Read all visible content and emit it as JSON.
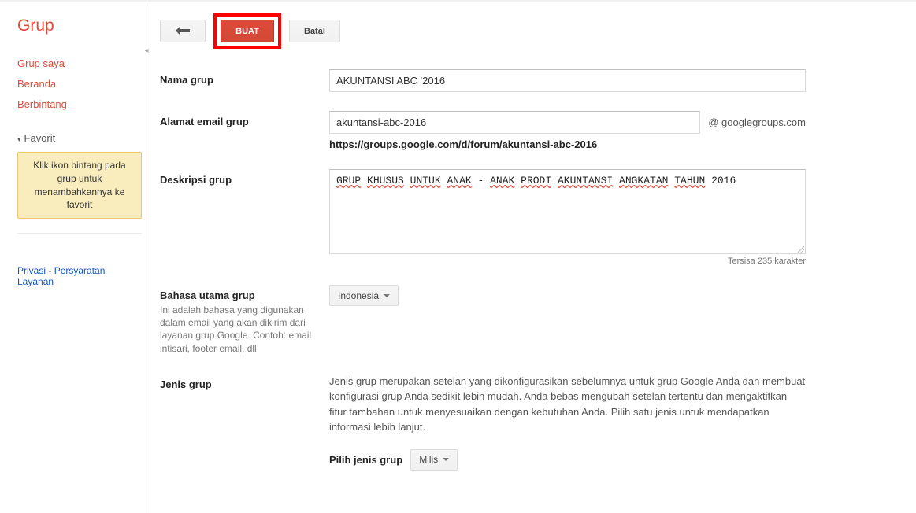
{
  "logo": "Grup",
  "sidebar": {
    "items": [
      "Grup saya",
      "Beranda",
      "Berbintang"
    ],
    "fav_header": "Favorit",
    "fav_tip": "Klik ikon bintang pada grup untuk menambahkannya ke favorit",
    "footer": {
      "privacy": "Privasi",
      "terms": "Persyaratan Layanan"
    }
  },
  "toolbar": {
    "buat": "BUAT",
    "batal": "Batal"
  },
  "form": {
    "name_label": "Nama grup",
    "name_value": "AKUNTANSI ABC '2016",
    "email_label": "Alamat email grup",
    "email_value": "akuntansi-abc-2016",
    "email_suffix": "@ googlegroups.com",
    "url_value": "https://groups.google.com/d/forum/akuntansi-abc-2016",
    "desc_label": "Deskripsi grup",
    "desc_words": [
      "GRUP",
      "KHUSUS",
      "UNTUK",
      "ANAK",
      "-",
      "ANAK",
      "PRODI",
      "AKUNTANSI",
      "ANGKATAN",
      "TAHUN"
    ],
    "desc_plain_tail": "2016",
    "char_remain": "Tersisa 235 karakter",
    "lang_label": "Bahasa utama grup",
    "lang_sub": "Ini adalah bahasa yang digunakan dalam email yang akan dikirim dari layanan grup Google. Contoh: email intisari, footer email, dll.",
    "lang_value": "Indonesia",
    "type_label": "Jenis grup",
    "type_info": "Jenis grup merupakan setelan yang dikonfigurasikan sebelumnya untuk grup Google Anda dan membuat konfigurasi grup Anda sedikit lebih mudah. Anda bebas mengubah setelan tertentu dan mengaktifkan fitur tambahan untuk menyesuaikan dengan kebutuhan Anda. Pilih satu jenis untuk mendapatkan informasi lebih lanjut.",
    "choose_label": "Pilih jenis grup",
    "choose_value": "Milis"
  }
}
